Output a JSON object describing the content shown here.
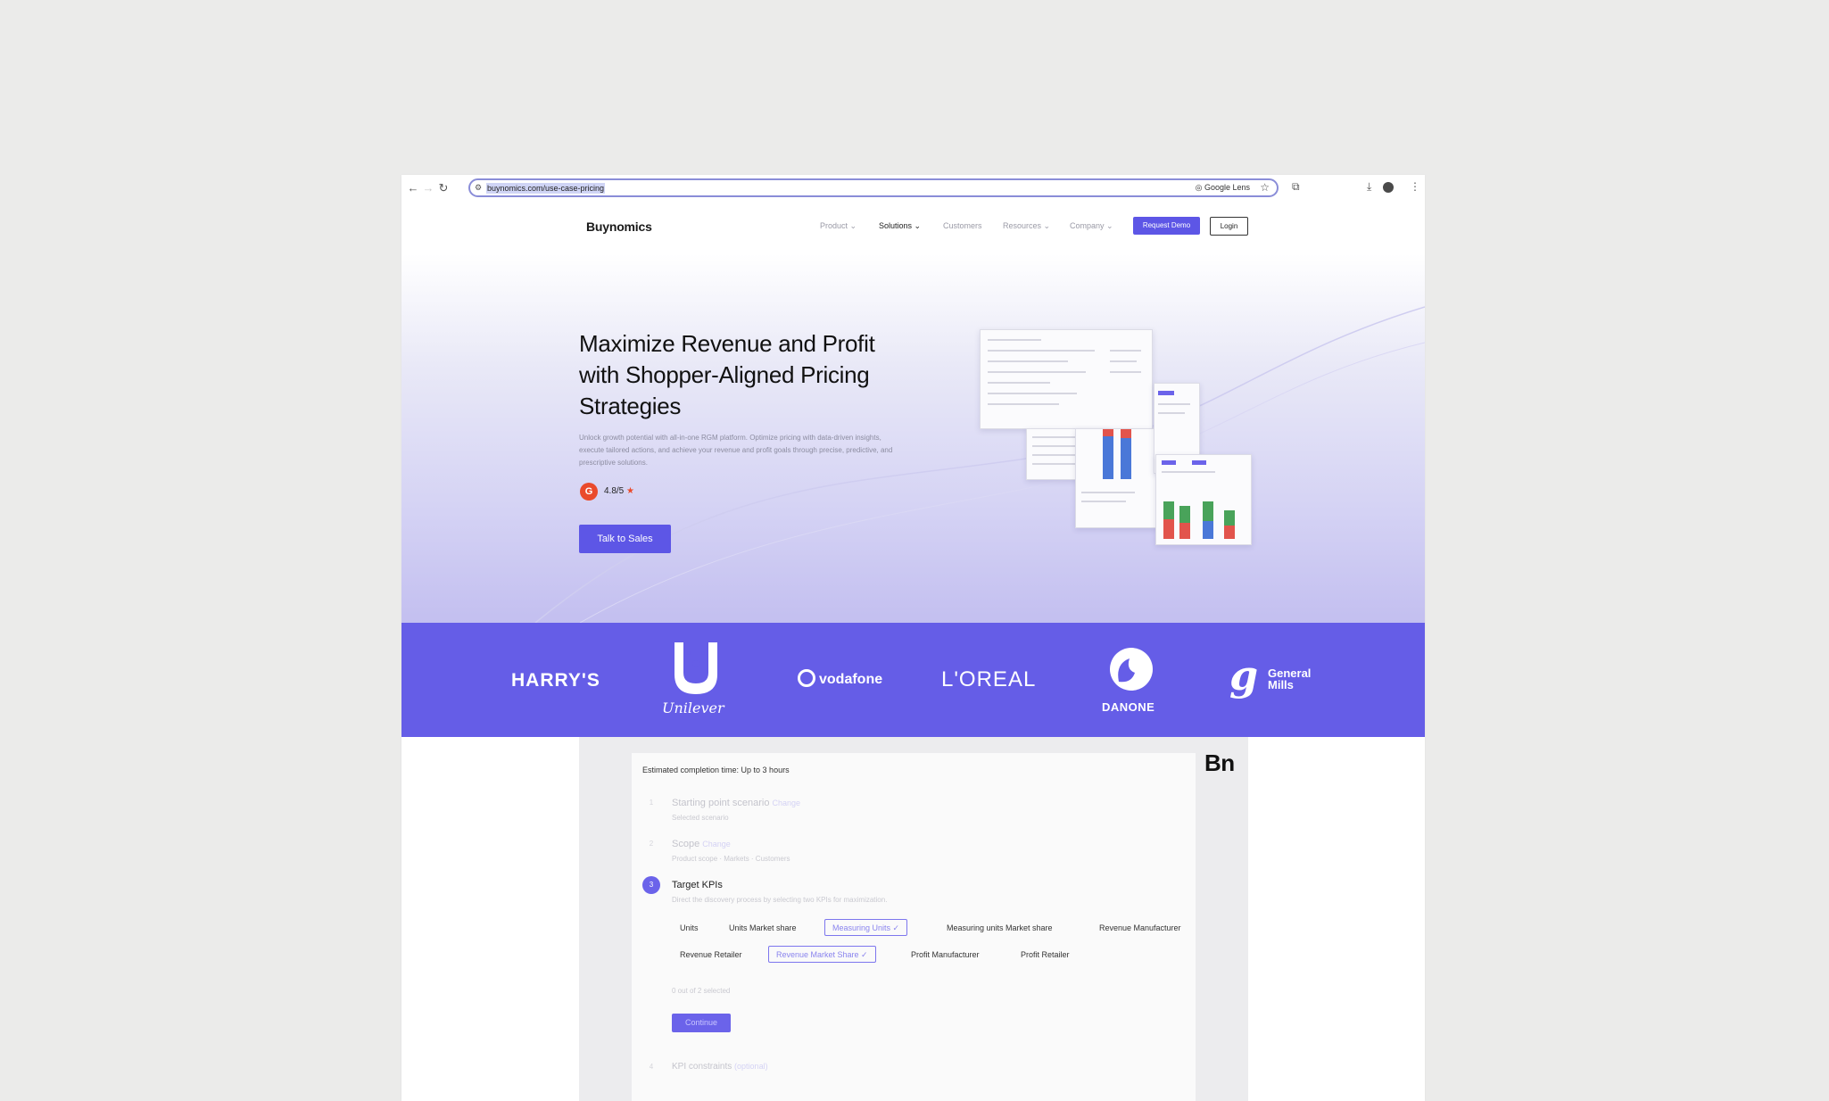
{
  "browser": {
    "url": "buynomics.com/use-case-pricing",
    "google_lens": "Google Lens",
    "back": "←",
    "forward": "→",
    "reload": "↻"
  },
  "site": {
    "logo": "Buynomics",
    "nav": [
      "Product ⌄",
      "Solutions ⌄",
      "Customers",
      "Resources ⌄",
      "Company ⌄"
    ],
    "request_demo": "Request Demo",
    "login": "Login"
  },
  "hero": {
    "title": "Maximize Revenue and Profit with Shopper-Aligned Pricing Strategies",
    "subtitle": "Unlock growth potential with all-in-one RGM platform. Optimize pricing with data-driven insights, execute tailored actions, and achieve your revenue and profit goals through precise, predictive, and prescriptive solutions.",
    "rating": "4.8/5",
    "rating_star": "★",
    "g2_label": "G",
    "cta": "Talk to Sales"
  },
  "brands": {
    "harrys": "HARRY'S",
    "unilever": "Unilever",
    "vodafone": "vodafone",
    "loreal": "L'OREAL",
    "danone": "DANONE",
    "general_mills": "General Mills"
  },
  "panel": {
    "estimated": "Estimated completion time: Up to 3 hours",
    "steps": [
      {
        "num": "1",
        "title": "Starting point scenario",
        "edit": "Change",
        "sub": "Selected scenario"
      },
      {
        "num": "2",
        "title": "Scope",
        "edit": "Change",
        "sub": "Product scope · Markets · Customers"
      },
      {
        "num": "3",
        "title": "Target KPIs",
        "sub": "Direct the discovery process by selecting two KPIs for maximization."
      },
      {
        "num": "4",
        "title": "KPI constraints",
        "edit": "(optional)"
      }
    ],
    "kpis_row1": [
      "Units",
      "Units Market share",
      "Measuring Units ✓",
      "Measuring units Market share",
      "Revenue Manufacturer"
    ],
    "kpis_row2": [
      "Revenue Retailer",
      "Revenue Market Share ✓",
      "Profit Manufacturer",
      "Profit Retailer"
    ],
    "selected_count": "0 out of 2 selected",
    "continue": "Continue"
  },
  "watermark": "Bn",
  "colors": {
    "accent": "#5d56e6",
    "band": "#655de7",
    "background": "#ebebea"
  }
}
